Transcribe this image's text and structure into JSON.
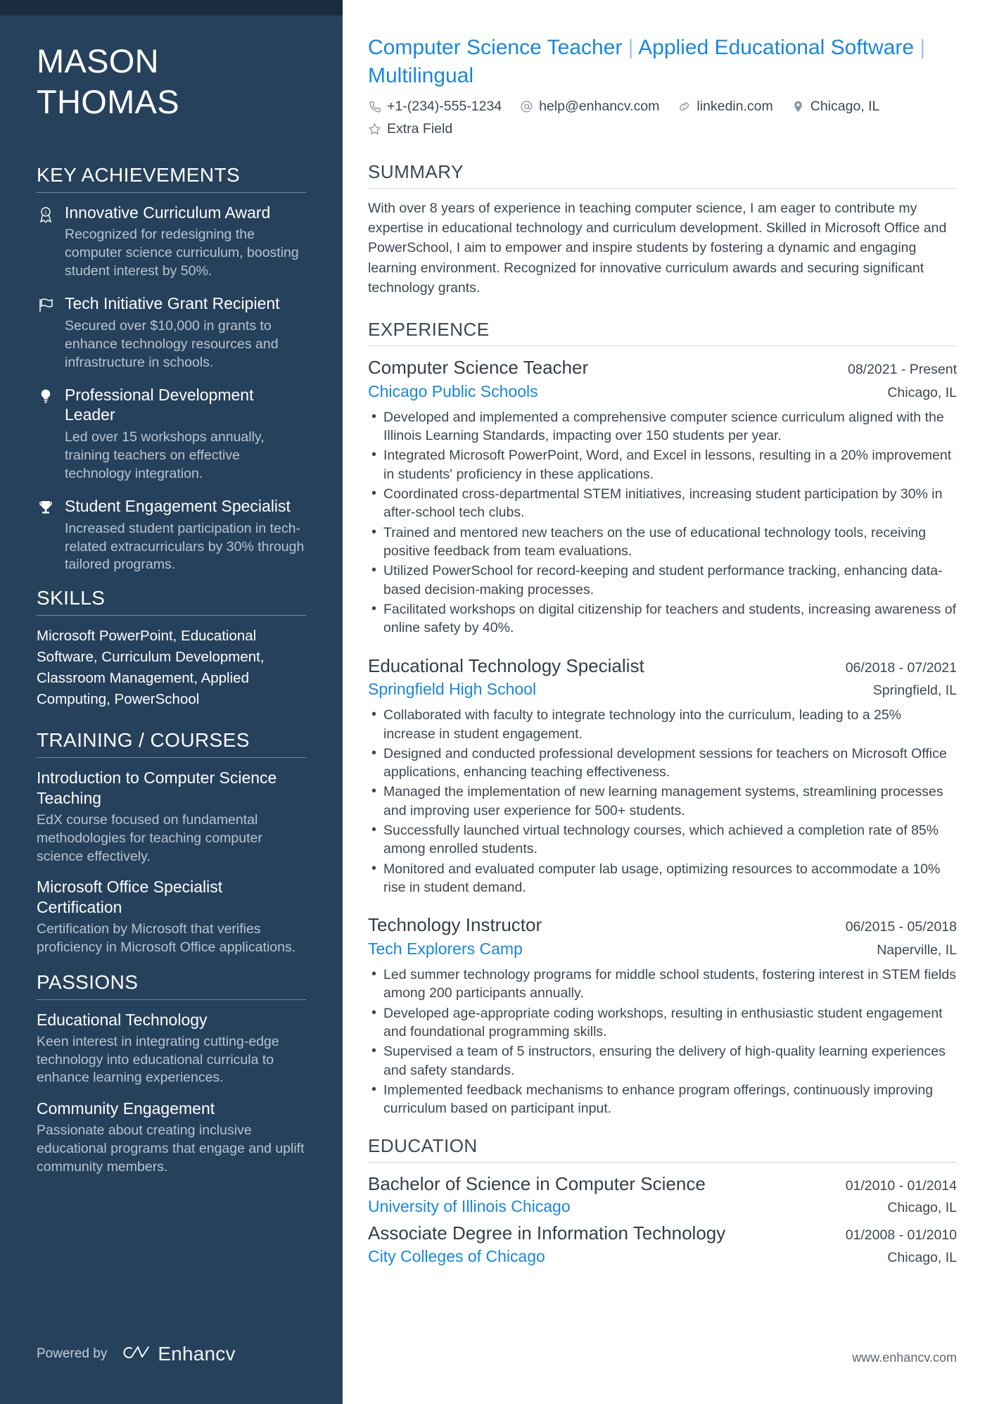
{
  "sidebar": {
    "name_lines": [
      "MASON",
      "THOMAS"
    ],
    "achievements": {
      "heading": "KEY ACHIEVEMENTS",
      "items": [
        {
          "icon": "award-ribbon-icon",
          "title": "Innovative Curriculum Award",
          "desc": "Recognized for redesigning the computer science curriculum, boosting student interest by 50%."
        },
        {
          "icon": "flag-icon",
          "title": "Tech Initiative Grant Recipient",
          "desc": "Secured over $10,000 in grants to enhance technology resources and infrastructure in schools."
        },
        {
          "icon": "lightbulb-icon",
          "title": "Professional Development Leader",
          "desc": "Led over 15 workshops annually, training teachers on effective technology integration."
        },
        {
          "icon": "trophy-icon",
          "title": "Student Engagement Specialist",
          "desc": "Increased student participation in tech-related extracurriculars by 30% through tailored programs."
        }
      ]
    },
    "skills": {
      "heading": "SKILLS",
      "text": "Microsoft PowerPoint, Educational Software, Curriculum Development, Classroom Management, Applied Computing, PowerSchool"
    },
    "training": {
      "heading": "TRAINING / COURSES",
      "items": [
        {
          "title": "Introduction to Computer Science Teaching",
          "desc": "EdX course focused on fundamental methodologies for teaching computer science effectively."
        },
        {
          "title": "Microsoft Office Specialist Certification",
          "desc": "Certification by Microsoft that verifies proficiency in Microsoft Office applications."
        }
      ]
    },
    "passions": {
      "heading": "PASSIONS",
      "items": [
        {
          "title": "Educational Technology",
          "desc": "Keen interest in integrating cutting-edge technology into educational curricula to enhance learning experiences."
        },
        {
          "title": "Community Engagement",
          "desc": "Passionate about creating inclusive educational programs that engage and uplift community members."
        }
      ]
    },
    "footer": {
      "powered_by": "Powered by",
      "brand": "Enhancv"
    }
  },
  "main": {
    "headline_parts": [
      "Computer Science Teacher",
      "Applied Educational Software",
      "Multilingual"
    ],
    "headline_separator": "|",
    "contacts": [
      {
        "icon": "phone-icon",
        "value": "+1-(234)-555-1234"
      },
      {
        "icon": "at-email-icon",
        "value": "help@enhancv.com"
      },
      {
        "icon": "link-icon",
        "value": "linkedin.com"
      },
      {
        "icon": "map-pin-icon",
        "value": "Chicago, IL"
      },
      {
        "icon": "star-icon",
        "value": "Extra Field"
      }
    ],
    "summary": {
      "heading": "SUMMARY",
      "text": "With over 8 years of experience in teaching computer science, I am eager to contribute my expertise in educational technology and curriculum development. Skilled in Microsoft Office and PowerSchool, I aim to empower and inspire students by fostering a dynamic and engaging learning environment. Recognized for innovative curriculum awards and securing significant technology grants."
    },
    "experience": {
      "heading": "EXPERIENCE",
      "jobs": [
        {
          "title": "Computer Science Teacher",
          "dates": "08/2021 - Present",
          "company": "Chicago Public Schools",
          "location": "Chicago, IL",
          "bullets": [
            "Developed and implemented a comprehensive computer science curriculum aligned with the Illinois Learning Standards, impacting over 150 students per year.",
            "Integrated Microsoft PowerPoint, Word, and Excel in lessons, resulting in a 20% improvement in students' proficiency in these applications.",
            "Coordinated cross-departmental STEM initiatives, increasing student participation by 30% in after-school tech clubs.",
            "Trained and mentored new teachers on the use of educational technology tools, receiving positive feedback from team evaluations.",
            "Utilized PowerSchool for record-keeping and student performance tracking, enhancing data-based decision-making processes.",
            "Facilitated workshops on digital citizenship for teachers and students, increasing awareness of online safety by 40%."
          ]
        },
        {
          "title": "Educational Technology Specialist",
          "dates": "06/2018 - 07/2021",
          "company": "Springfield High School",
          "location": "Springfield, IL",
          "bullets": [
            "Collaborated with faculty to integrate technology into the curriculum, leading to a 25% increase in student engagement.",
            "Designed and conducted professional development sessions for teachers on Microsoft Office applications, enhancing teaching effectiveness.",
            "Managed the implementation of new learning management systems, streamlining processes and improving user experience for 500+ students.",
            "Successfully launched virtual technology courses, which achieved a completion rate of 85% among enrolled students.",
            "Monitored and evaluated computer lab usage, optimizing resources to accommodate a 10% rise in student demand."
          ]
        },
        {
          "title": "Technology Instructor",
          "dates": "06/2015 - 05/2018",
          "company": "Tech Explorers Camp",
          "location": "Naperville, IL",
          "bullets": [
            "Led summer technology programs for middle school students, fostering interest in STEM fields among 200 participants annually.",
            "Developed age-appropriate coding workshops, resulting in enthusiastic student engagement and foundational programming skills.",
            "Supervised a team of 5 instructors, ensuring the delivery of high-quality learning experiences and safety standards.",
            "Implemented feedback mechanisms to enhance program offerings, continuously improving curriculum based on participant input."
          ]
        }
      ]
    },
    "education": {
      "heading": "EDUCATION",
      "items": [
        {
          "degree": "Bachelor of Science in Computer Science",
          "dates": "01/2010 - 01/2014",
          "school": "University of Illinois Chicago",
          "location": "Chicago, IL"
        },
        {
          "degree": "Associate Degree in Information Technology",
          "dates": "01/2008 - 01/2010",
          "school": "City Colleges of Chicago",
          "location": "Chicago, IL"
        }
      ]
    },
    "footer_url": "www.enhancv.com"
  },
  "colors": {
    "sidebar_bg": "#26415c",
    "sidebar_topbar": "#1b2c3f",
    "accent_blue": "#1787e0",
    "body_text": "#3c4752"
  }
}
